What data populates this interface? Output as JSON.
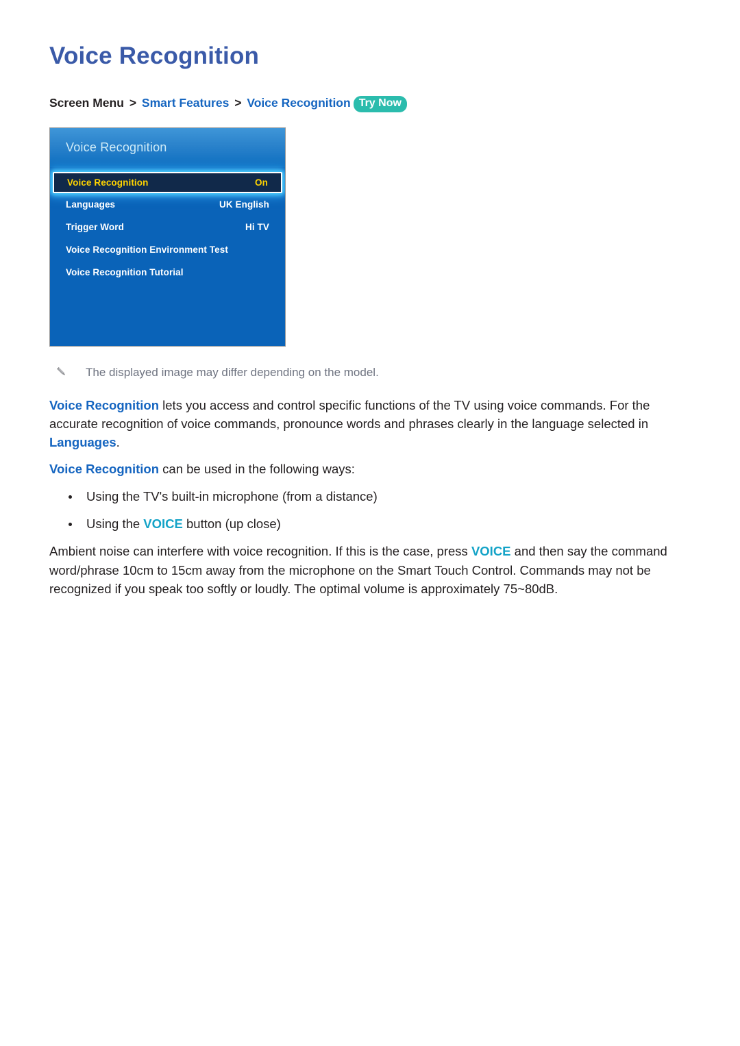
{
  "page": {
    "title": "Voice Recognition"
  },
  "breadcrumb": {
    "root": "Screen Menu",
    "sep": ">",
    "level1": "Smart Features",
    "level2": "Voice Recognition",
    "badge": "Try Now"
  },
  "tv_panel": {
    "header_title": "Voice Recognition",
    "rows": [
      {
        "label": "Voice Recognition",
        "value": "On",
        "selected": true
      },
      {
        "label": "Languages",
        "value": "UK English",
        "selected": false
      },
      {
        "label": "Trigger Word",
        "value": "Hi TV",
        "selected": false
      },
      {
        "label": "Voice Recognition Environment Test",
        "value": "",
        "selected": false
      },
      {
        "label": "Voice Recognition Tutorial",
        "value": "",
        "selected": false
      }
    ],
    "colors": {
      "panel_body": "#0a63b8",
      "header_gradient_top": "#3f96d8",
      "header_title_text": "#cdeaf7",
      "selected_row_bg": "#11294a",
      "selected_row_text": "#ffd400",
      "selected_glow": "#50d2ff"
    }
  },
  "note": {
    "icon": "pencil-icon",
    "text": "The displayed image may differ depending on the model."
  },
  "body": {
    "para1": {
      "kw1": "Voice Recognition",
      "t1": " lets you access and control specific functions of the TV using voice commands. For the accurate recognition of voice commands, pronounce words and phrases clearly in the language selected in ",
      "kw2": "Languages",
      "t2": "."
    },
    "para2": {
      "kw1": "Voice Recognition",
      "t1": " can be used in the following ways:"
    },
    "bullets": [
      {
        "pre": "Using the TV's built-in microphone (from a distance)",
        "kw": "",
        "post": ""
      },
      {
        "pre": "Using the ",
        "kw": "VOICE",
        "post": " button (up close)"
      }
    ],
    "para3": {
      "t1": "Ambient noise can interfere with voice recognition. If this is the case, press ",
      "kw1": "VOICE",
      "t2": " and then say the command word/phrase 10cm to 15cm away from the microphone on the Smart Touch Control. Commands may not be recognized if you speak too softly or loudly. The optimal volume is approximately 75~80dB."
    }
  },
  "colors": {
    "title": "#3a5aa8",
    "link_blue": "#1565c0",
    "keyword_teal": "#14a3c7",
    "badge_teal": "#2bbcad",
    "note_gray": "#6e7380",
    "body_text": "#231f20"
  }
}
